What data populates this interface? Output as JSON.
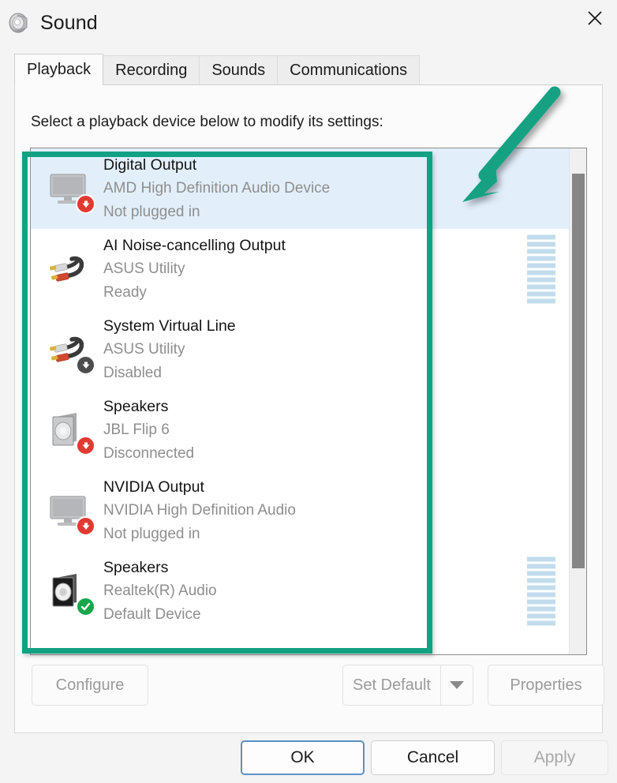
{
  "window": {
    "title": "Sound",
    "icon": "speaker-icon",
    "close_label": "✕"
  },
  "tabs": [
    {
      "label": "Playback",
      "active": true
    },
    {
      "label": "Recording",
      "active": false
    },
    {
      "label": "Sounds",
      "active": false
    },
    {
      "label": "Communications",
      "active": false
    }
  ],
  "panel": {
    "instruction": "Select a playback device below to modify its settings:"
  },
  "devices": [
    {
      "name": "Digital Output",
      "driver": "AMD High Definition Audio Device",
      "status": "Not plugged in",
      "icon": "monitor-icon",
      "badge": "red-down-arrow",
      "selected": true,
      "meter_segments": 0
    },
    {
      "name": "AI Noise-cancelling Output",
      "driver": "ASUS Utility",
      "status": "Ready",
      "icon": "rca-cable-icon",
      "badge": "none",
      "selected": false,
      "meter_segments": 10
    },
    {
      "name": "System Virtual Line",
      "driver": "ASUS Utility",
      "status": "Disabled",
      "icon": "rca-cable-icon",
      "badge": "gray-down-arrow",
      "selected": false,
      "meter_segments": 0
    },
    {
      "name": "Speakers",
      "driver": "JBL Flip 6",
      "status": "Disconnected",
      "icon": "speaker-box-icon",
      "badge": "red-down-arrow",
      "selected": false,
      "meter_segments": 0
    },
    {
      "name": "NVIDIA Output",
      "driver": "NVIDIA High Definition Audio",
      "status": "Not plugged in",
      "icon": "monitor-icon",
      "badge": "red-down-arrow",
      "selected": false,
      "meter_segments": 0
    },
    {
      "name": "Speakers",
      "driver": "Realtek(R) Audio",
      "status": "Default Device",
      "icon": "speaker-box-dark-icon",
      "badge": "green-check",
      "selected": false,
      "meter_segments": 10
    }
  ],
  "mid_buttons": {
    "configure": "Configure",
    "set_default": "Set Default",
    "set_default_arrow": "chevron-down-icon",
    "properties": "Properties"
  },
  "footer_buttons": {
    "ok": "OK",
    "cancel": "Cancel",
    "apply": "Apply"
  },
  "annotations": {
    "highlight_color": "#13a183",
    "arrow_color": "#13a183",
    "arrow_direction": "down-left"
  },
  "colors": {
    "selection": "#e2effb",
    "meter": "#c2dced",
    "badge_red": "#e03a32",
    "badge_green": "#17a74a",
    "badge_gray": "#4d4d4d",
    "accent": "#13a183"
  }
}
